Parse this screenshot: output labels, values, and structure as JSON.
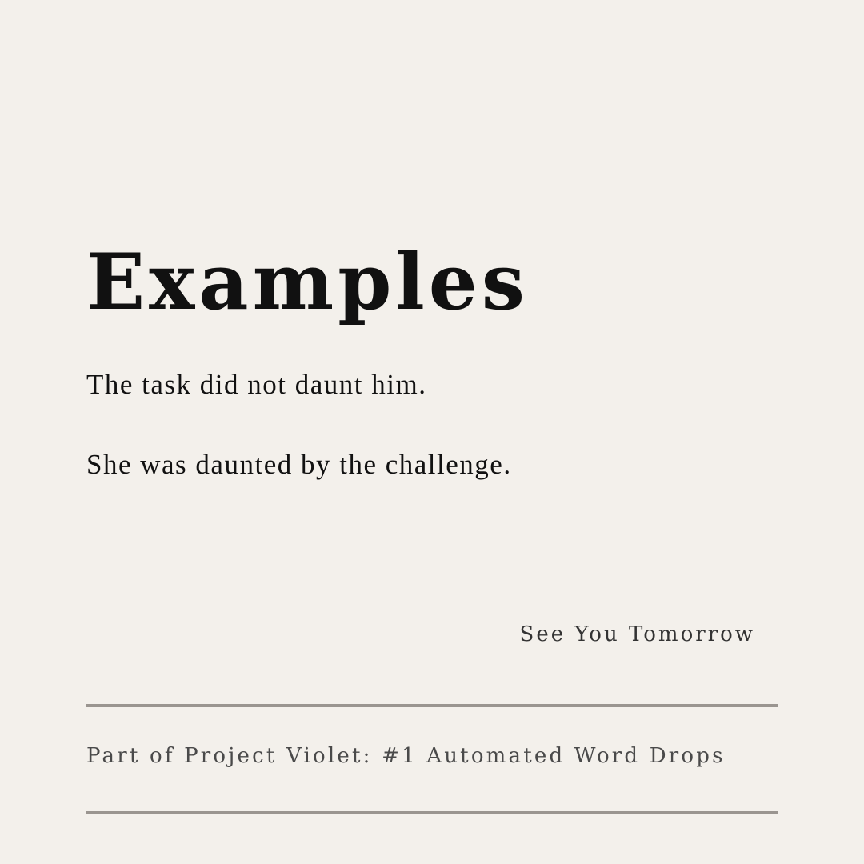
{
  "heading": "Examples",
  "examples": [
    "The task did not daunt him.",
    "She was daunted by the challenge."
  ],
  "signoff": "See You Tomorrow",
  "footer": "Part of Project Violet: #1 Automated Word Drops",
  "colors": {
    "background": "#f3f0eb",
    "text": "#111111",
    "rule": "#9a9590"
  }
}
